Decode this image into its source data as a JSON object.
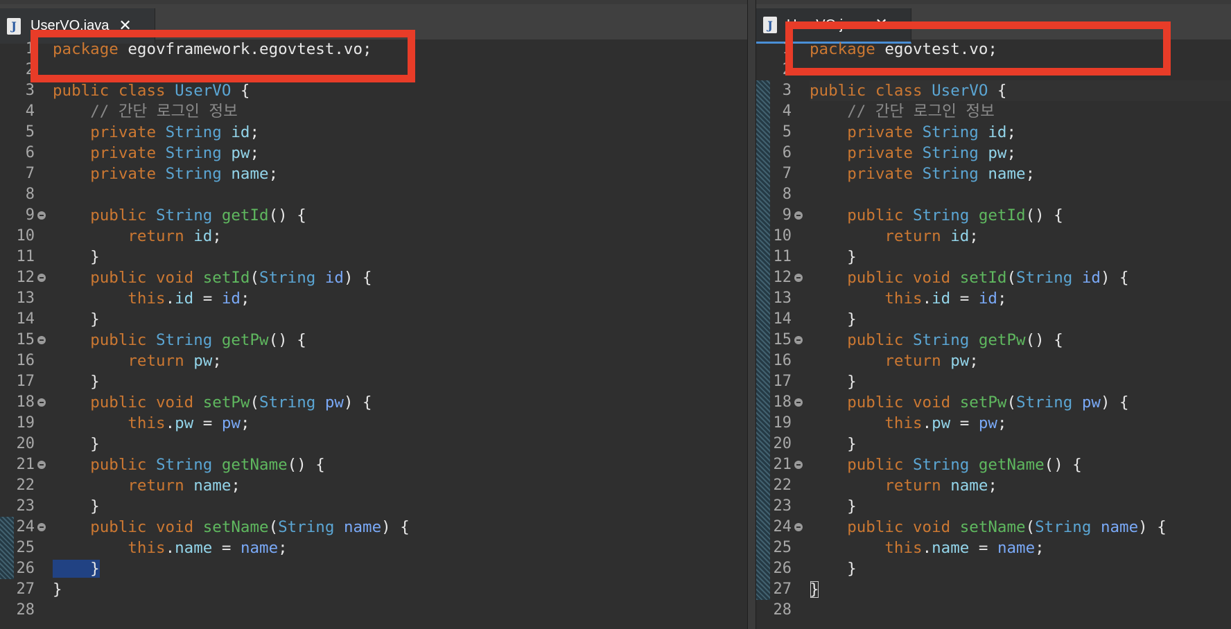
{
  "left": {
    "tab": {
      "label": "UserVO.java",
      "icon": "java-file-icon"
    },
    "lines": [
      {
        "n": "1",
        "t": [
          [
            "kw",
            "package "
          ],
          [
            "pl",
            "egovframework.egovtest.vo;"
          ]
        ]
      },
      {
        "n": "2",
        "t": []
      },
      {
        "n": "3",
        "t": [
          [
            "kw",
            "public "
          ],
          [
            "kw",
            "class "
          ],
          [
            "ty",
            "UserVO"
          ],
          [
            "pl",
            " {"
          ]
        ]
      },
      {
        "n": "4",
        "t": [
          [
            "pl",
            "    "
          ],
          [
            "cm",
            "// 간단 로그인 정보"
          ]
        ]
      },
      {
        "n": "5",
        "t": [
          [
            "pl",
            "    "
          ],
          [
            "kw",
            "private "
          ],
          [
            "ty",
            "String "
          ],
          [
            "fld",
            "id"
          ],
          [
            "pl",
            ";"
          ]
        ]
      },
      {
        "n": "6",
        "t": [
          [
            "pl",
            "    "
          ],
          [
            "kw",
            "private "
          ],
          [
            "ty",
            "String "
          ],
          [
            "fld",
            "pw"
          ],
          [
            "pl",
            ";"
          ]
        ]
      },
      {
        "n": "7",
        "t": [
          [
            "pl",
            "    "
          ],
          [
            "kw",
            "private "
          ],
          [
            "ty",
            "String "
          ],
          [
            "fld",
            "name"
          ],
          [
            "pl",
            ";"
          ]
        ]
      },
      {
        "n": "8",
        "t": []
      },
      {
        "n": "9",
        "fold": true,
        "t": [
          [
            "pl",
            "    "
          ],
          [
            "kw",
            "public "
          ],
          [
            "ty",
            "String "
          ],
          [
            "fn",
            "getId"
          ],
          [
            "pl",
            "() {"
          ]
        ]
      },
      {
        "n": "10",
        "t": [
          [
            "pl",
            "        "
          ],
          [
            "kw",
            "return "
          ],
          [
            "fld",
            "id"
          ],
          [
            "pl",
            ";"
          ]
        ]
      },
      {
        "n": "11",
        "t": [
          [
            "pl",
            "    }"
          ]
        ]
      },
      {
        "n": "12",
        "fold": true,
        "t": [
          [
            "pl",
            "    "
          ],
          [
            "kw",
            "public "
          ],
          [
            "kw",
            "void "
          ],
          [
            "fn",
            "setId"
          ],
          [
            "pl",
            "("
          ],
          [
            "ty",
            "String "
          ],
          [
            "prm",
            "id"
          ],
          [
            "pl",
            ") {"
          ]
        ]
      },
      {
        "n": "13",
        "t": [
          [
            "pl",
            "        "
          ],
          [
            "kw",
            "this"
          ],
          [
            "pl",
            "."
          ],
          [
            "fld",
            "id"
          ],
          [
            "pl",
            " = "
          ],
          [
            "prm",
            "id"
          ],
          [
            "pl",
            ";"
          ]
        ]
      },
      {
        "n": "14",
        "t": [
          [
            "pl",
            "    }"
          ]
        ]
      },
      {
        "n": "15",
        "fold": true,
        "t": [
          [
            "pl",
            "    "
          ],
          [
            "kw",
            "public "
          ],
          [
            "ty",
            "String "
          ],
          [
            "fn",
            "getPw"
          ],
          [
            "pl",
            "() {"
          ]
        ]
      },
      {
        "n": "16",
        "t": [
          [
            "pl",
            "        "
          ],
          [
            "kw",
            "return "
          ],
          [
            "fld",
            "pw"
          ],
          [
            "pl",
            ";"
          ]
        ]
      },
      {
        "n": "17",
        "t": [
          [
            "pl",
            "    }"
          ]
        ]
      },
      {
        "n": "18",
        "fold": true,
        "t": [
          [
            "pl",
            "    "
          ],
          [
            "kw",
            "public "
          ],
          [
            "kw",
            "void "
          ],
          [
            "fn",
            "setPw"
          ],
          [
            "pl",
            "("
          ],
          [
            "ty",
            "String "
          ],
          [
            "prm",
            "pw"
          ],
          [
            "pl",
            ") {"
          ]
        ]
      },
      {
        "n": "19",
        "t": [
          [
            "pl",
            "        "
          ],
          [
            "kw",
            "this"
          ],
          [
            "pl",
            "."
          ],
          [
            "fld",
            "pw"
          ],
          [
            "pl",
            " = "
          ],
          [
            "prm",
            "pw"
          ],
          [
            "pl",
            ";"
          ]
        ]
      },
      {
        "n": "20",
        "t": [
          [
            "pl",
            "    }"
          ]
        ]
      },
      {
        "n": "21",
        "fold": true,
        "t": [
          [
            "pl",
            "    "
          ],
          [
            "kw",
            "public "
          ],
          [
            "ty",
            "String "
          ],
          [
            "fn",
            "getName"
          ],
          [
            "pl",
            "() {"
          ]
        ]
      },
      {
        "n": "22",
        "t": [
          [
            "pl",
            "        "
          ],
          [
            "kw",
            "return "
          ],
          [
            "fld",
            "name"
          ],
          [
            "pl",
            ";"
          ]
        ]
      },
      {
        "n": "23",
        "t": [
          [
            "pl",
            "    }"
          ]
        ]
      },
      {
        "n": "24",
        "fold": true,
        "t": [
          [
            "pl",
            "    "
          ],
          [
            "kw",
            "public "
          ],
          [
            "kw",
            "void "
          ],
          [
            "fn",
            "setName"
          ],
          [
            "pl",
            "("
          ],
          [
            "ty",
            "String "
          ],
          [
            "prm",
            "name"
          ],
          [
            "pl",
            ") {"
          ]
        ]
      },
      {
        "n": "25",
        "t": [
          [
            "pl",
            "        "
          ],
          [
            "kw",
            "this"
          ],
          [
            "pl",
            "."
          ],
          [
            "fld",
            "name"
          ],
          [
            "pl",
            " = "
          ],
          [
            "prm",
            "name"
          ],
          [
            "pl",
            ";"
          ]
        ]
      },
      {
        "n": "26",
        "sel": true,
        "t": [
          [
            "pl",
            "    }"
          ]
        ]
      },
      {
        "n": "27",
        "t": [
          [
            "pl",
            "}"
          ]
        ]
      },
      {
        "n": "28",
        "t": []
      }
    ]
  },
  "right": {
    "tab": {
      "label": "UserVO.java",
      "icon": "java-file-icon"
    },
    "lines": [
      {
        "n": "1",
        "t": [
          [
            "kw",
            "package "
          ],
          [
            "pl",
            "egovtest.vo;"
          ]
        ]
      },
      {
        "n": "2",
        "t": []
      },
      {
        "n": "3",
        "cur": true,
        "t": [
          [
            "kw",
            "public "
          ],
          [
            "kw",
            "class "
          ],
          [
            "ty",
            "UserVO"
          ],
          [
            "pl",
            " {"
          ]
        ]
      },
      {
        "n": "4",
        "t": [
          [
            "pl",
            "    "
          ],
          [
            "cm",
            "// 간단 로그인 정보"
          ]
        ]
      },
      {
        "n": "5",
        "t": [
          [
            "pl",
            "    "
          ],
          [
            "kw",
            "private "
          ],
          [
            "ty",
            "String "
          ],
          [
            "fld",
            "id"
          ],
          [
            "pl",
            ";"
          ]
        ]
      },
      {
        "n": "6",
        "t": [
          [
            "pl",
            "    "
          ],
          [
            "kw",
            "private "
          ],
          [
            "ty",
            "String "
          ],
          [
            "fld",
            "pw"
          ],
          [
            "pl",
            ";"
          ]
        ]
      },
      {
        "n": "7",
        "t": [
          [
            "pl",
            "    "
          ],
          [
            "kw",
            "private "
          ],
          [
            "ty",
            "String "
          ],
          [
            "fld",
            "name"
          ],
          [
            "pl",
            ";"
          ]
        ]
      },
      {
        "n": "8",
        "t": []
      },
      {
        "n": "9",
        "fold": true,
        "t": [
          [
            "pl",
            "    "
          ],
          [
            "kw",
            "public "
          ],
          [
            "ty",
            "String "
          ],
          [
            "fn",
            "getId"
          ],
          [
            "pl",
            "() {"
          ]
        ]
      },
      {
        "n": "10",
        "t": [
          [
            "pl",
            "        "
          ],
          [
            "kw",
            "return "
          ],
          [
            "fld",
            "id"
          ],
          [
            "pl",
            ";"
          ]
        ]
      },
      {
        "n": "11",
        "t": [
          [
            "pl",
            "    }"
          ]
        ]
      },
      {
        "n": "12",
        "fold": true,
        "t": [
          [
            "pl",
            "    "
          ],
          [
            "kw",
            "public "
          ],
          [
            "kw",
            "void "
          ],
          [
            "fn",
            "setId"
          ],
          [
            "pl",
            "("
          ],
          [
            "ty",
            "String "
          ],
          [
            "prm",
            "id"
          ],
          [
            "pl",
            ") {"
          ]
        ]
      },
      {
        "n": "13",
        "t": [
          [
            "pl",
            "        "
          ],
          [
            "kw",
            "this"
          ],
          [
            "pl",
            "."
          ],
          [
            "fld",
            "id"
          ],
          [
            "pl",
            " = "
          ],
          [
            "prm",
            "id"
          ],
          [
            "pl",
            ";"
          ]
        ]
      },
      {
        "n": "14",
        "t": [
          [
            "pl",
            "    }"
          ]
        ]
      },
      {
        "n": "15",
        "fold": true,
        "t": [
          [
            "pl",
            "    "
          ],
          [
            "kw",
            "public "
          ],
          [
            "ty",
            "String "
          ],
          [
            "fn",
            "getPw"
          ],
          [
            "pl",
            "() {"
          ]
        ]
      },
      {
        "n": "16",
        "t": [
          [
            "pl",
            "        "
          ],
          [
            "kw",
            "return "
          ],
          [
            "fld",
            "pw"
          ],
          [
            "pl",
            ";"
          ]
        ]
      },
      {
        "n": "17",
        "t": [
          [
            "pl",
            "    }"
          ]
        ]
      },
      {
        "n": "18",
        "fold": true,
        "t": [
          [
            "pl",
            "    "
          ],
          [
            "kw",
            "public "
          ],
          [
            "kw",
            "void "
          ],
          [
            "fn",
            "setPw"
          ],
          [
            "pl",
            "("
          ],
          [
            "ty",
            "String "
          ],
          [
            "prm",
            "pw"
          ],
          [
            "pl",
            ") {"
          ]
        ]
      },
      {
        "n": "19",
        "t": [
          [
            "pl",
            "        "
          ],
          [
            "kw",
            "this"
          ],
          [
            "pl",
            "."
          ],
          [
            "fld",
            "pw"
          ],
          [
            "pl",
            " = "
          ],
          [
            "prm",
            "pw"
          ],
          [
            "pl",
            ";"
          ]
        ]
      },
      {
        "n": "20",
        "t": [
          [
            "pl",
            "    }"
          ]
        ]
      },
      {
        "n": "21",
        "fold": true,
        "t": [
          [
            "pl",
            "    "
          ],
          [
            "kw",
            "public "
          ],
          [
            "ty",
            "String "
          ],
          [
            "fn",
            "getName"
          ],
          [
            "pl",
            "() {"
          ]
        ]
      },
      {
        "n": "22",
        "t": [
          [
            "pl",
            "        "
          ],
          [
            "kw",
            "return "
          ],
          [
            "fld",
            "name"
          ],
          [
            "pl",
            ";"
          ]
        ]
      },
      {
        "n": "23",
        "t": [
          [
            "pl",
            "    }"
          ]
        ]
      },
      {
        "n": "24",
        "fold": true,
        "t": [
          [
            "pl",
            "    "
          ],
          [
            "kw",
            "public "
          ],
          [
            "kw",
            "void "
          ],
          [
            "fn",
            "setName"
          ],
          [
            "pl",
            "("
          ],
          [
            "ty",
            "String "
          ],
          [
            "prm",
            "name"
          ],
          [
            "pl",
            ") {"
          ]
        ]
      },
      {
        "n": "25",
        "t": [
          [
            "pl",
            "        "
          ],
          [
            "kw",
            "this"
          ],
          [
            "pl",
            "."
          ],
          [
            "fld",
            "name"
          ],
          [
            "pl",
            " = "
          ],
          [
            "prm",
            "name"
          ],
          [
            "pl",
            ";"
          ]
        ]
      },
      {
        "n": "26",
        "t": [
          [
            "pl",
            "    }"
          ]
        ]
      },
      {
        "n": "27",
        "bracket": true,
        "t": [
          [
            "pl",
            "}"
          ]
        ]
      },
      {
        "n": "28",
        "t": []
      }
    ]
  },
  "colors": {
    "keyword": "#cc7832",
    "type": "#5ba6d4",
    "method": "#5fb85f",
    "field": "#93d5ea",
    "parameter": "#7aa9f7",
    "comment": "#8a8a8a",
    "annotation_box": "#e83c28"
  }
}
